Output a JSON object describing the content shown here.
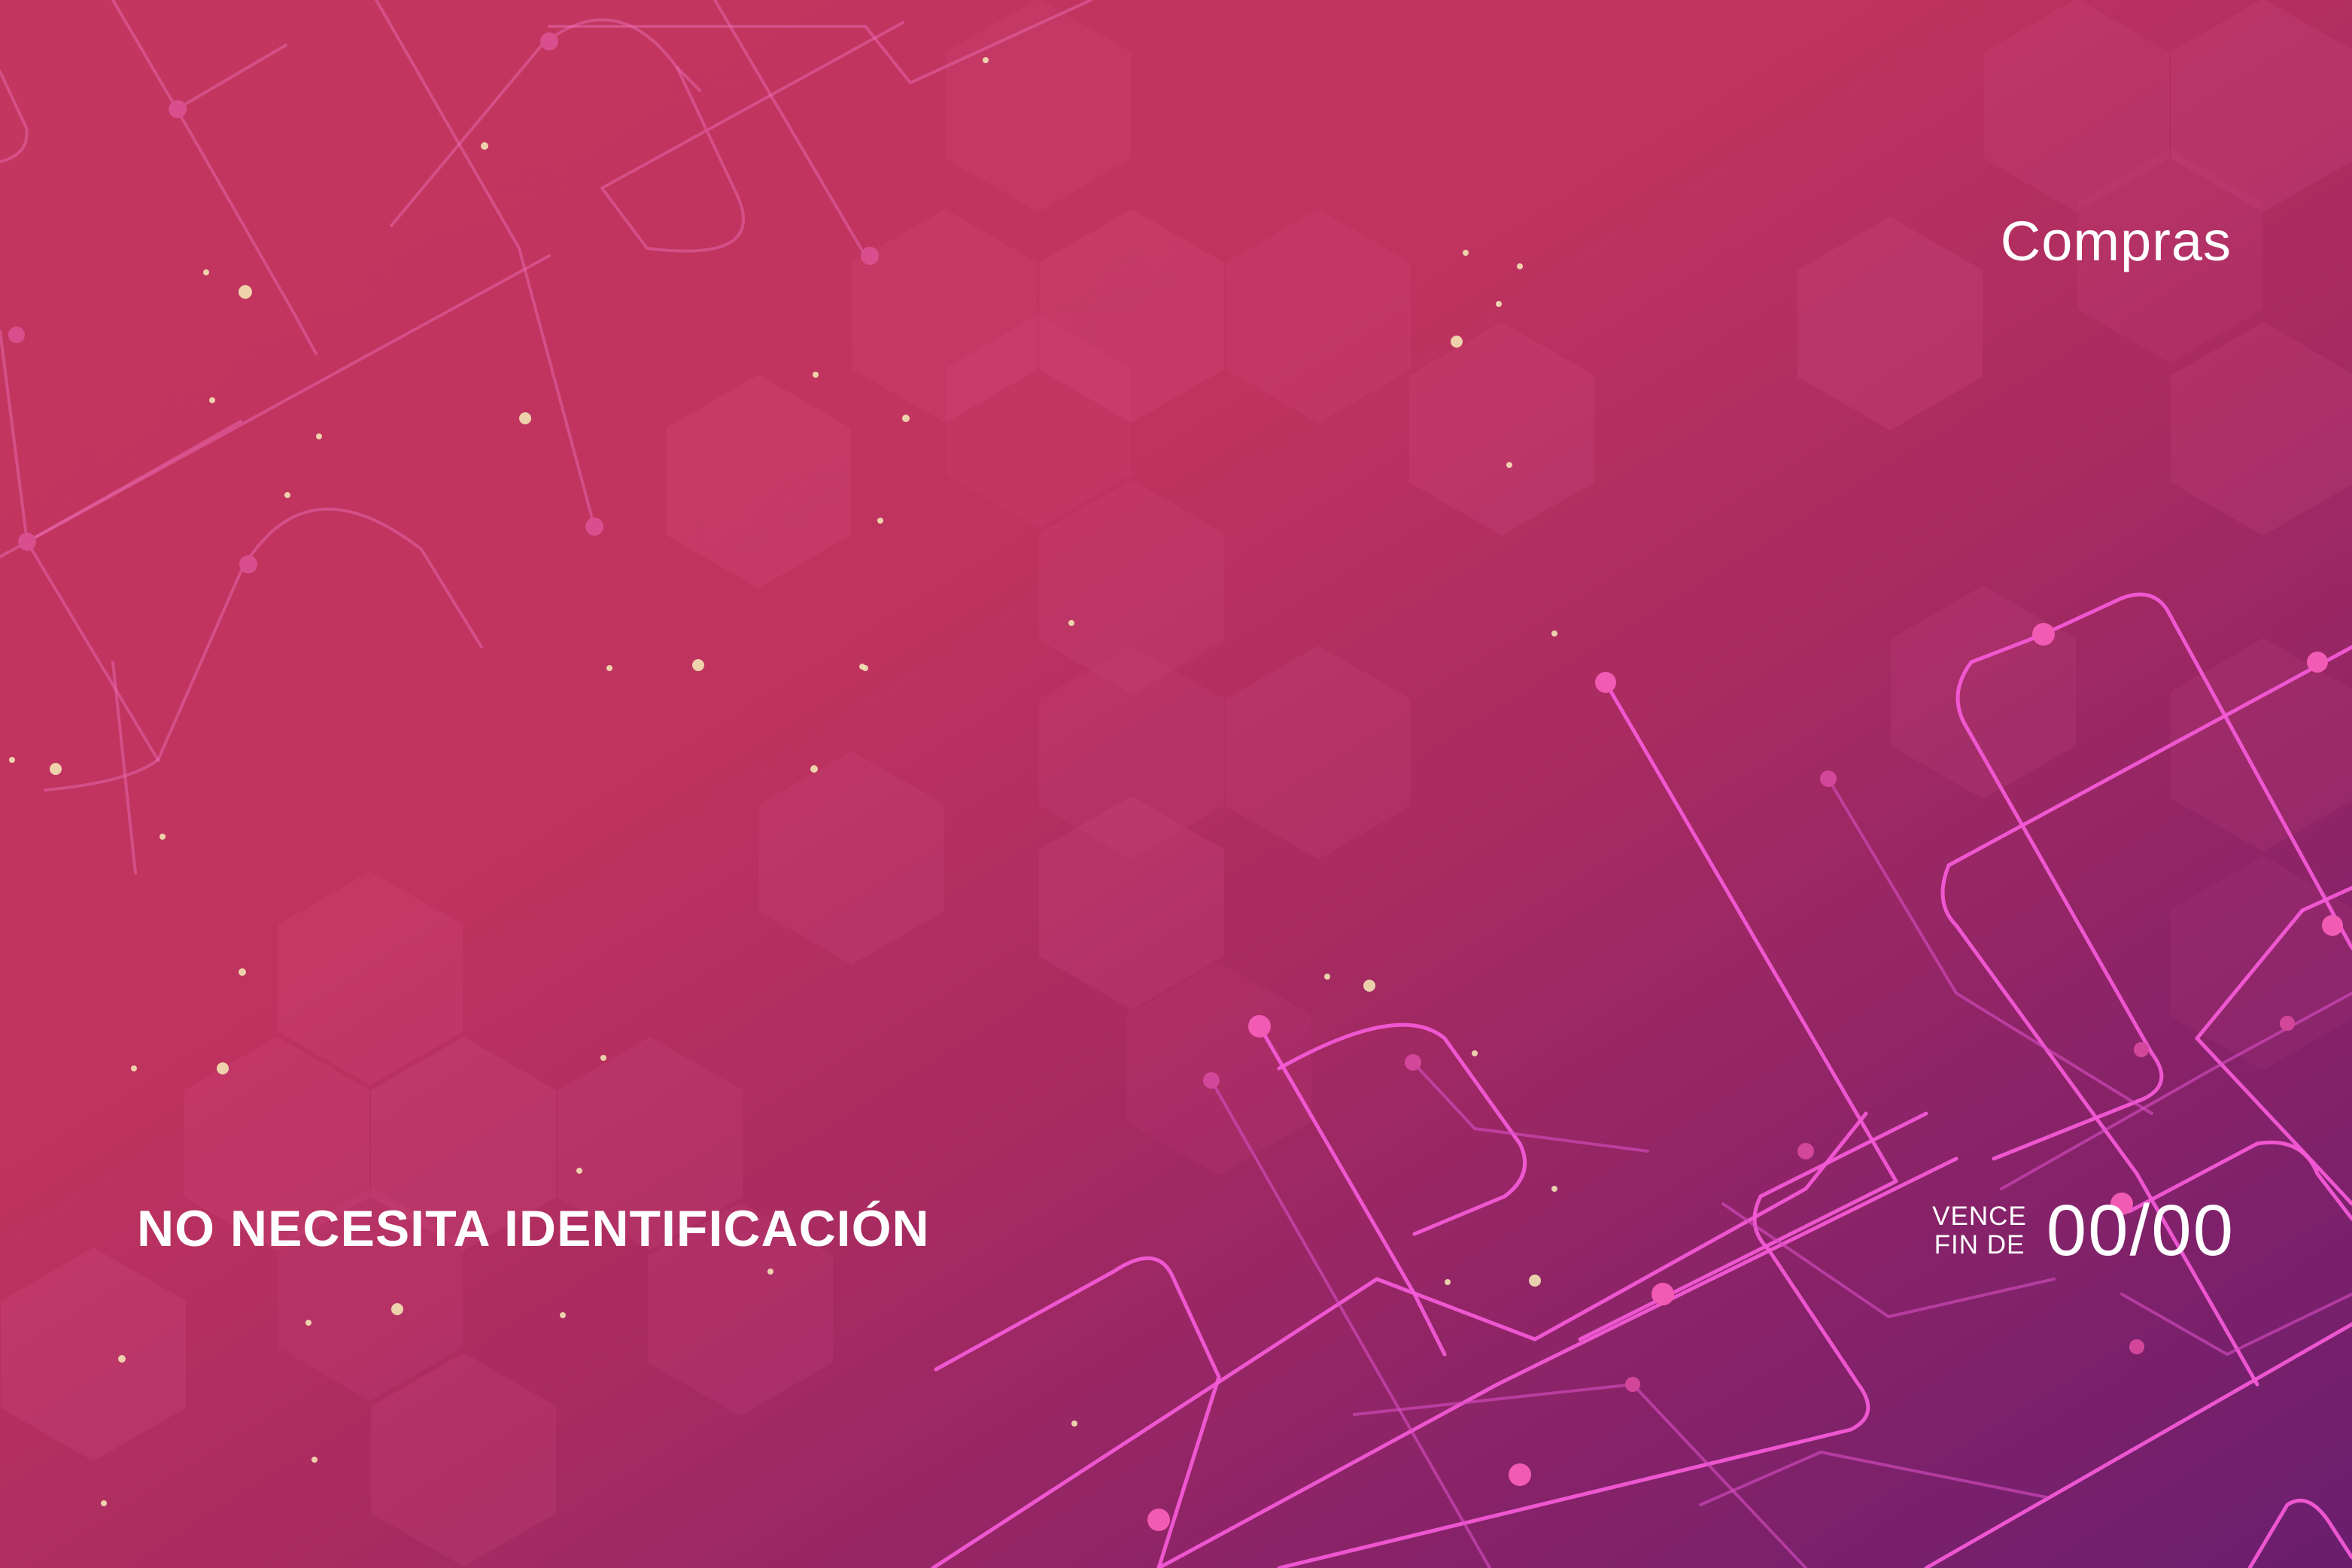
{
  "card": {
    "brand_label": "Compras",
    "notice_text": "NO NECESITA IDENTIFICACIÓN",
    "expiry": {
      "line1": "VENCE",
      "line2": "FIN DE",
      "date": "00/00"
    }
  },
  "colors": {
    "background_start": "#c3365f",
    "background_end": "#6a1e6e",
    "hexagon_fill": "#e25c98",
    "circuit_line": "#f35ad6",
    "particle": "#f3e3b4",
    "text": "#ffffff"
  }
}
